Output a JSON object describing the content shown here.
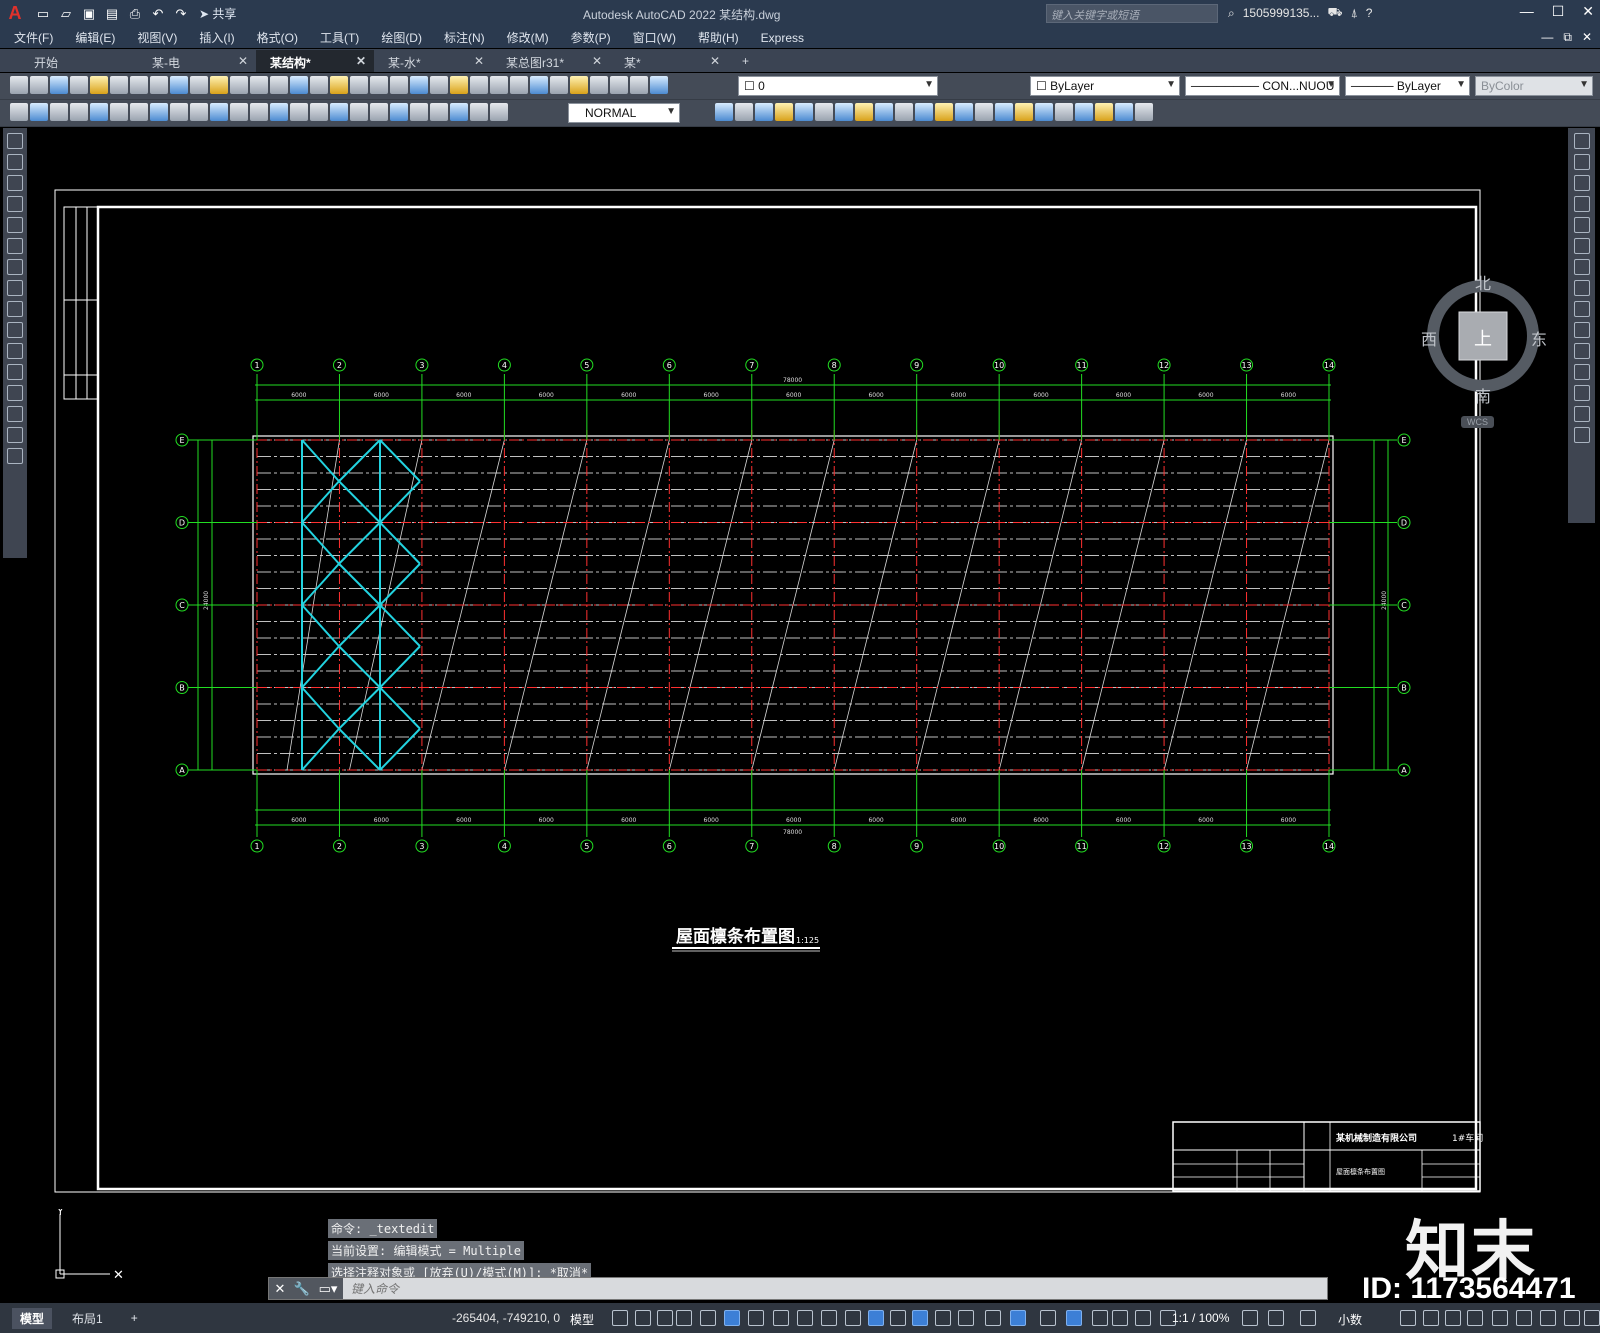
{
  "titlebar": {
    "share_label": "共享",
    "app_title": "Autodesk AutoCAD 2022    某结构.dwg",
    "search_placeholder": "键入关键字或短语",
    "user": "1505999135...",
    "help": "?"
  },
  "menu": [
    "文件(F)",
    "编辑(E)",
    "视图(V)",
    "插入(I)",
    "格式(O)",
    "工具(T)",
    "绘图(D)",
    "标注(N)",
    "修改(M)",
    "参数(P)",
    "窗口(W)",
    "帮助(H)",
    "Express"
  ],
  "tabs": [
    {
      "label": "开始",
      "closable": false
    },
    {
      "label": "某-电",
      "closable": true
    },
    {
      "label": "某结构*",
      "closable": true,
      "active": true
    },
    {
      "label": "某-水*",
      "closable": true
    },
    {
      "label": "某总图r31*",
      "closable": true
    },
    {
      "label": "某*",
      "closable": true
    }
  ],
  "toolbar1": {
    "layer_value": "0",
    "color_value": "ByLayer",
    "linetype_value": "CON...NUOU",
    "lineweight_value": "ByLayer",
    "plotstyle_value": "ByColor"
  },
  "toolbar2": {
    "dimstyle_value": "NORMAL"
  },
  "viewcube": {
    "north": "北",
    "south": "南",
    "east": "东",
    "west": "西",
    "top": "上",
    "wcs": "WCS"
  },
  "drawing": {
    "axis_top": [
      "1",
      "2",
      "3",
      "4",
      "5",
      "6",
      "7",
      "8",
      "9",
      "10",
      "11",
      "12",
      "13",
      "14"
    ],
    "axis_side": [
      "E",
      "D",
      "C",
      "B",
      "A"
    ],
    "span_label": "6000",
    "total_length": "78000",
    "total_width": "24000",
    "title": "屋面檩条布置图",
    "scale": "1:125",
    "title_block": {
      "company": "某机械制造有限公司",
      "project": "1#车间",
      "drawing_name": "屋面檩条布置图"
    }
  },
  "command": {
    "history": [
      "命令: _textedit",
      "当前设置: 编辑模式 = Multiple",
      "选择注释对象或 [放弃(U)/模式(M)]: *取消*"
    ],
    "placeholder": "键入命令"
  },
  "status": {
    "layout_tabs": [
      "模型",
      "布局1"
    ],
    "coords": "-265404, -749210, 0",
    "model": "模型",
    "scale": "1:1 / 100%",
    "units": "小数"
  },
  "brand": {
    "name": "知末",
    "id": "ID: 1173564471"
  }
}
